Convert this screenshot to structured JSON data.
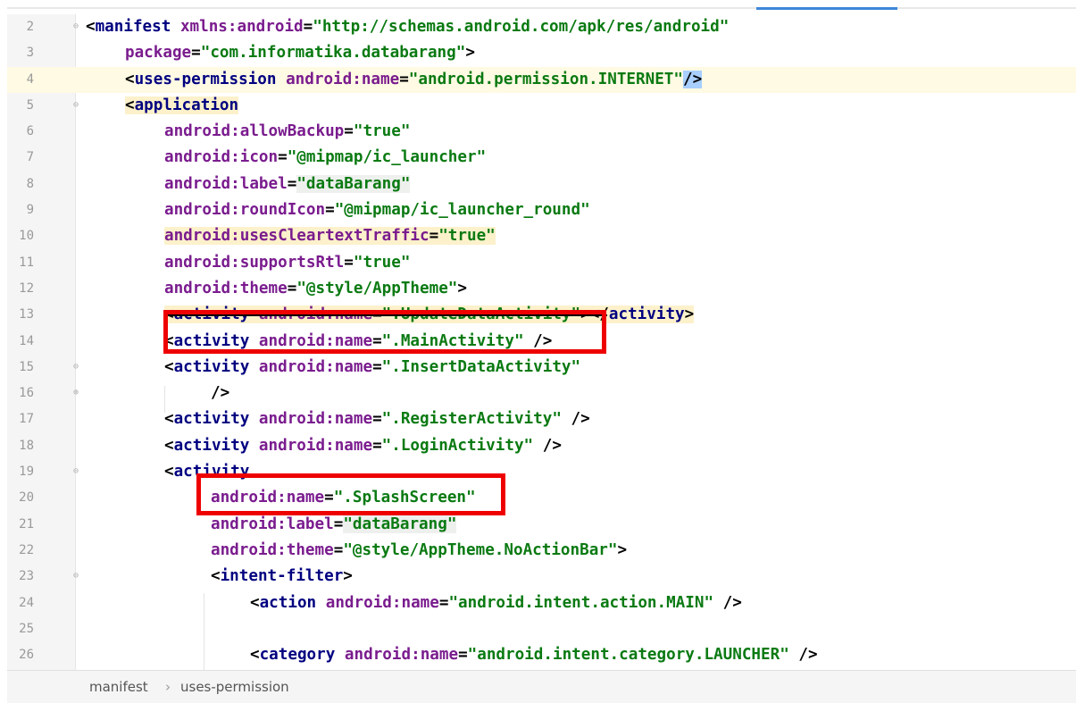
{
  "tab_indicator": "active-file-tab",
  "lines": [
    {
      "num": "2"
    },
    {
      "num": "3"
    },
    {
      "num": "4"
    },
    {
      "num": "5"
    },
    {
      "num": "6"
    },
    {
      "num": "7"
    },
    {
      "num": "8"
    },
    {
      "num": "9"
    },
    {
      "num": "10"
    },
    {
      "num": "11"
    },
    {
      "num": "12"
    },
    {
      "num": "13"
    },
    {
      "num": "14"
    },
    {
      "num": "15"
    },
    {
      "num": "16"
    },
    {
      "num": "17"
    },
    {
      "num": "18"
    },
    {
      "num": "19"
    },
    {
      "num": "20"
    },
    {
      "num": "21"
    },
    {
      "num": "22"
    },
    {
      "num": "23"
    },
    {
      "num": "24"
    },
    {
      "num": "25"
    },
    {
      "num": "26"
    }
  ],
  "code": {
    "l2": {
      "open": "<",
      "tag": "manifest",
      "ns": "xmlns",
      "colon": ":",
      "attr": "android",
      "eq": "=",
      "val": "\"http://schemas.android.com/apk/res/android\""
    },
    "l3": {
      "attr": "package",
      "eq": "=",
      "val": "\"com.informatika.databarang\"",
      "close": ">"
    },
    "l4": {
      "open": "<",
      "tag": "uses-permission",
      "ns": "android",
      "colon": ":",
      "attr": "name",
      "eq": "=",
      "val": "\"android.permission.INTERNET\"",
      "close": "/>"
    },
    "l5": {
      "open": "<",
      "tag": "application"
    },
    "l6": {
      "ns": "android",
      "colon": ":",
      "attr": "allowBackup",
      "eq": "=",
      "val": "\"true\""
    },
    "l7": {
      "ns": "android",
      "colon": ":",
      "attr": "icon",
      "eq": "=",
      "val": "\"@mipmap/ic_launcher\""
    },
    "l8": {
      "ns": "android",
      "colon": ":",
      "attr": "label",
      "eq": "=",
      "q1": "\"",
      "val": "dataBarang",
      "q2": "\""
    },
    "l9": {
      "ns": "android",
      "colon": ":",
      "attr": "roundIcon",
      "eq": "=",
      "val": "\"@mipmap/ic_launcher_round\""
    },
    "l10": {
      "ns": "android",
      "colon": ":",
      "attr": "usesCleartextTraffic",
      "eq": "=",
      "val": "\"true\""
    },
    "l11": {
      "ns": "android",
      "colon": ":",
      "attr": "supportsRtl",
      "eq": "=",
      "val": "\"true\""
    },
    "l12": {
      "ns": "android",
      "colon": ":",
      "attr": "theme",
      "eq": "=",
      "val": "\"@style/AppTheme\"",
      "close": ">"
    },
    "l13": {
      "open": "<",
      "tag": "activity",
      "ns": " android",
      "colon": ":",
      "attr": "name",
      "eq": "=",
      "val": "\".UpdateDataActivity\"",
      "close": "></",
      "tag2": "activity",
      "close2": ">"
    },
    "l14": {
      "open": "<",
      "tag": "activity",
      "ns": " android",
      "colon": ":",
      "attr": "name",
      "eq": "=",
      "val": "\".MainActivity\"",
      "close": " />"
    },
    "l15": {
      "open": "<",
      "tag": "activity",
      "ns": " android",
      "colon": ":",
      "attr": "name",
      "eq": "=",
      "val": "\".InsertDataActivity\""
    },
    "l16": {
      "close": "/>"
    },
    "l17": {
      "open": "<",
      "tag": "activity",
      "ns": " android",
      "colon": ":",
      "attr": "name",
      "eq": "=",
      "val": "\".RegisterActivity\"",
      "close": " />"
    },
    "l18": {
      "open": "<",
      "tag": "activity",
      "ns": " android",
      "colon": ":",
      "attr": "name",
      "eq": "=",
      "val": "\".LoginActivity\"",
      "close": " />"
    },
    "l19": {
      "open": "<",
      "tag": "activity"
    },
    "l20": {
      "ns": "android",
      "colon": ":",
      "attr": "name",
      "eq": "=",
      "val": "\".SplashScreen\""
    },
    "l21": {
      "ns": "android",
      "colon": ":",
      "attr": "label",
      "eq": "=",
      "q1": "\"",
      "val": "dataBarang",
      "q2": "\""
    },
    "l22": {
      "ns": "android",
      "colon": ":",
      "attr": "theme",
      "eq": "=",
      "val": "\"@style/AppTheme.NoActionBar\"",
      "close": ">"
    },
    "l23": {
      "open": "<",
      "tag": "intent-filter",
      "close": ">"
    },
    "l24": {
      "open": "<",
      "tag": "action",
      "ns": " android",
      "colon": ":",
      "attr": "name",
      "eq": "=",
      "val": "\"android.intent.action.MAIN\"",
      "close": " />"
    },
    "l26": {
      "open": "<",
      "tag": "category",
      "ns": " android",
      "colon": ":",
      "attr": "name",
      "eq": "=",
      "val": "\"android.intent.category.LAUNCHER\"",
      "close": " />"
    }
  },
  "breadcrumb": {
    "item1": "manifest",
    "sep": "›",
    "item2": "uses-permission"
  },
  "colors": {
    "tag": "#000080",
    "attribute": "#7a1c8e",
    "value": "#0a7a12",
    "annotation_box": "#ee0000",
    "current_line": "#fffae3"
  }
}
